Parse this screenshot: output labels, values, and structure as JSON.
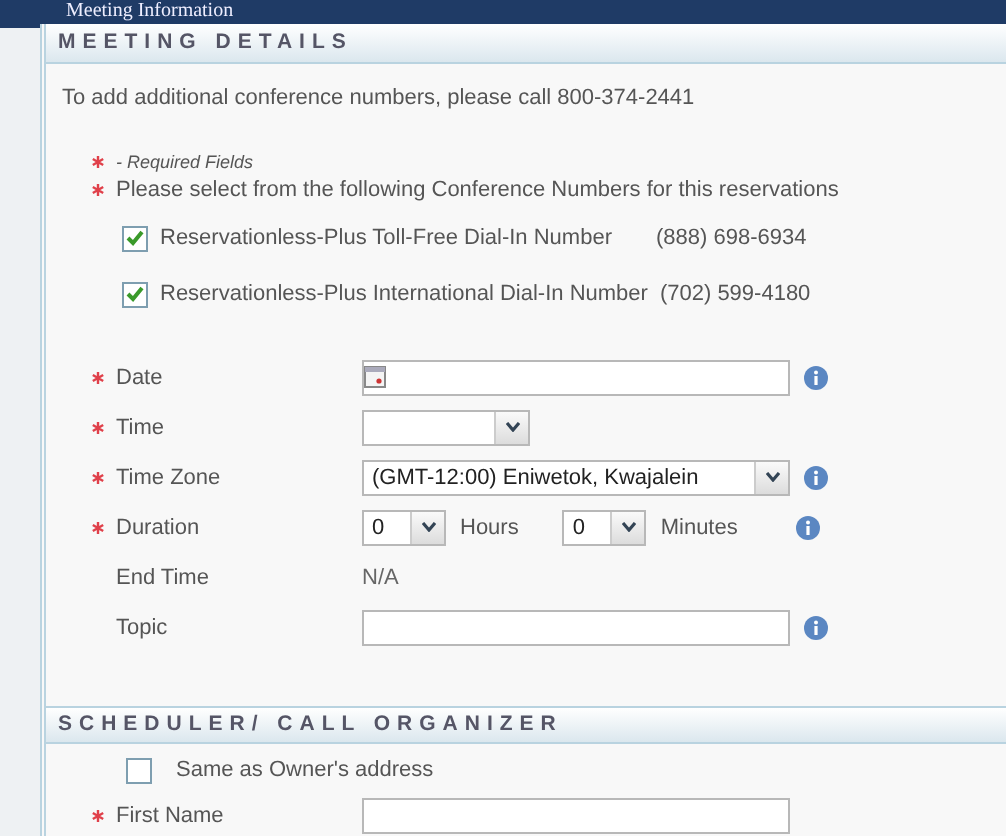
{
  "header": {
    "title": "Meeting Information"
  },
  "meeting_details": {
    "title": "MEETING DETAILS",
    "note": "To add additional conference numbers, please call 800-374-2441",
    "required_note": "- Required Fields",
    "conference_prompt": "Please select from the following Conference Numbers for this reservations",
    "conference_numbers": [
      {
        "label": "Reservationless-Plus Toll-Free Dial-In Number",
        "number": "(888) 698-6934",
        "checked": true
      },
      {
        "label": "Reservationless-Plus International Dial-In Number",
        "number": "(702) 599-4180",
        "checked": true
      }
    ],
    "fields": [
      {
        "kind": "date",
        "label": "Date",
        "required": true,
        "info": true
      },
      {
        "kind": "time",
        "label": "Time",
        "required": true,
        "info": false
      },
      {
        "kind": "select",
        "label": "Time Zone",
        "required": true,
        "value": "(GMT-12:00) Eniwetok, Kwajalein",
        "info": true
      },
      {
        "kind": "duration",
        "label": "Duration",
        "required": true,
        "hours": "0",
        "hours_unit": "Hours",
        "minutes": "0",
        "minutes_unit": "Minutes",
        "info": true
      },
      {
        "kind": "text",
        "label": "End Time",
        "required": false,
        "value": "N/A",
        "info": false
      },
      {
        "kind": "input",
        "label": "Topic",
        "required": false,
        "info": true
      }
    ]
  },
  "scheduler": {
    "title": "SCHEDULER/ CALL ORGANIZER",
    "same_as_owner": {
      "label": "Same as Owner's address",
      "checked": false
    },
    "fields": [
      {
        "kind": "input",
        "label": "First Name",
        "required": true,
        "info": false
      }
    ]
  }
}
